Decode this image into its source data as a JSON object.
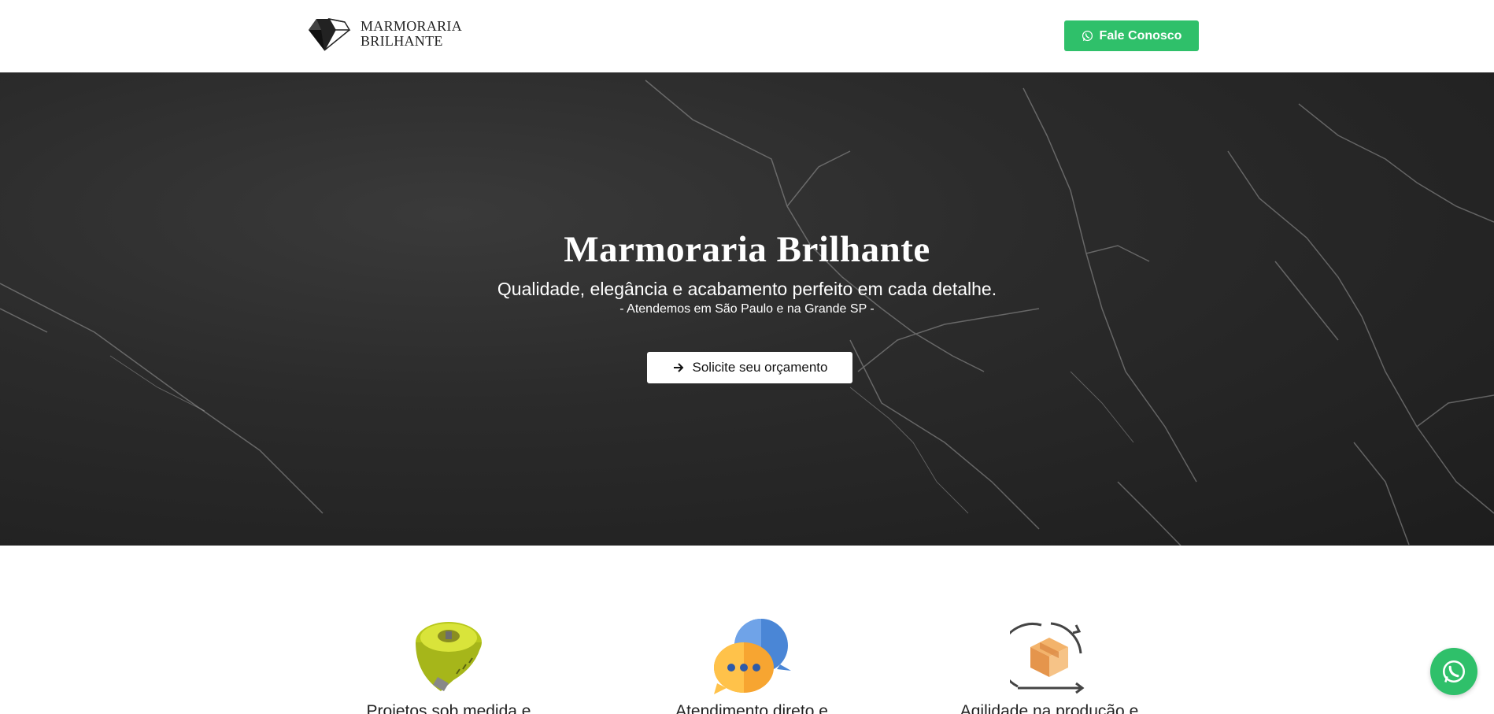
{
  "header": {
    "brand_line1": "MARMORARIA",
    "brand_line2": "BRILHANTE",
    "contact_button": "Fale Conosco"
  },
  "hero": {
    "title": "Marmoraria Brilhante",
    "subtitle": "Qualidade, elegância e acabamento perfeito em cada detalhe.",
    "service_area": "- Atendemos em São Paulo e na Grande SP -",
    "cta_button": "Solicite seu orçamento"
  },
  "features": [
    {
      "icon": "measuring-tape-icon",
      "label": "Projetos sob medida e"
    },
    {
      "icon": "chat-bubbles-icon",
      "label": "Atendimento direto e"
    },
    {
      "icon": "box-cycle-icon",
      "label": "Agilidade na produção e"
    }
  ],
  "colors": {
    "accent_green": "#2fc06a",
    "hero_bg": "#2b2b2b"
  }
}
